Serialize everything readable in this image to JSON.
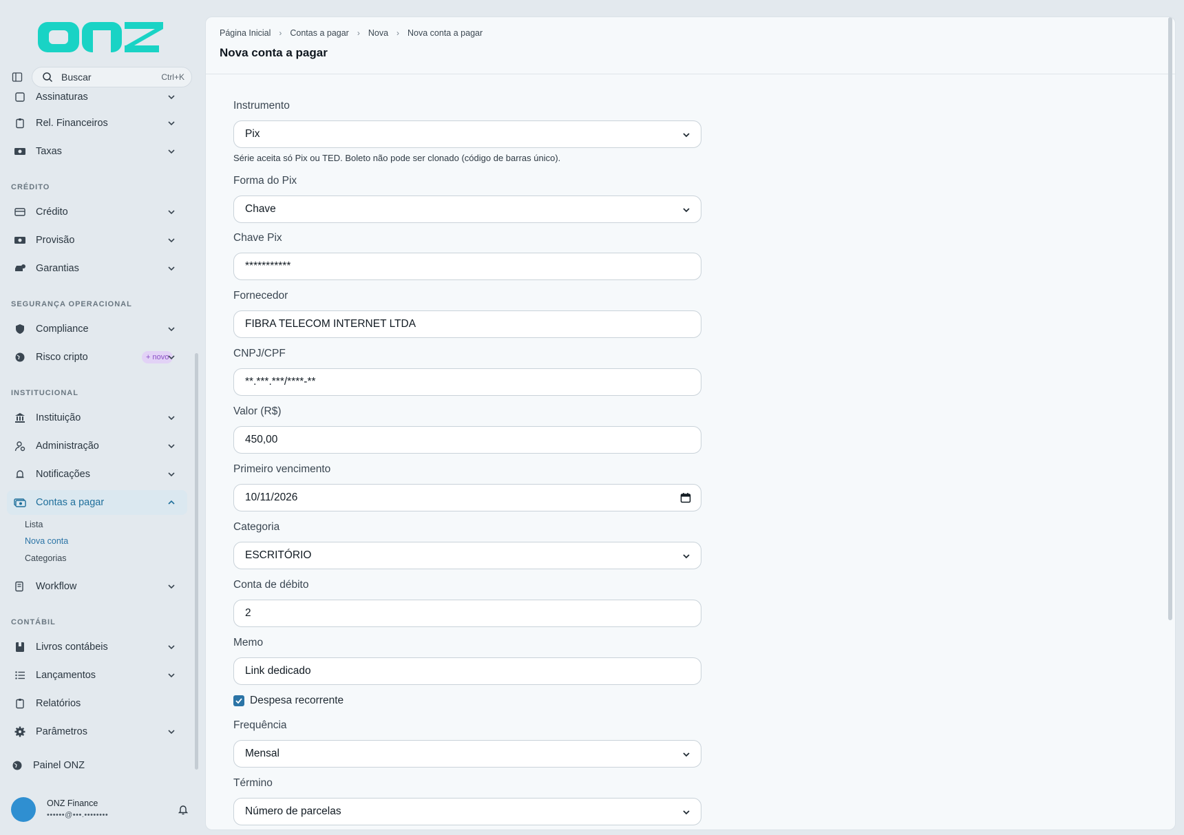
{
  "sidebar": {
    "logo_text": "onz",
    "search_label": "Buscar",
    "search_shortcut": "Ctrl+K",
    "items_top": [
      {
        "label": "Assinaturas"
      },
      {
        "label": "Rel. Financeiros"
      },
      {
        "label": "Taxas"
      }
    ],
    "section_credito": "CRÉDITO",
    "credito_items": [
      {
        "label": "Crédito"
      },
      {
        "label": "Provisão"
      },
      {
        "label": "Garantias"
      }
    ],
    "section_seguranca": "SEGURANÇA OPERACIONAL",
    "seguranca_items": [
      {
        "label": "Compliance"
      },
      {
        "label": "Risco cripto",
        "badge": "+ novo"
      }
    ],
    "section_institucional": "INSTITUCIONAL",
    "institucional_items": [
      {
        "label": "Instituição"
      },
      {
        "label": "Administração"
      },
      {
        "label": "Notificações"
      },
      {
        "label": "Contas a pagar"
      }
    ],
    "contas_sub": [
      {
        "label": "Lista"
      },
      {
        "label": "Nova conta"
      },
      {
        "label": "Categorias"
      }
    ],
    "workflow": "Workflow",
    "section_contabil": "CONTÁBIL",
    "contabil_items": [
      {
        "label": "Livros contábeis"
      },
      {
        "label": "Lançamentos"
      },
      {
        "label": "Relatórios"
      },
      {
        "label": "Parâmetros"
      }
    ],
    "painel": "Painel ONZ",
    "user_name": "ONZ Finance",
    "user_email": "••••••@•••.••••••••"
  },
  "header": {
    "breadcrumbs": [
      "Página Inicial",
      "Contas a pagar",
      "Nova",
      "Nova conta a pagar"
    ],
    "title": "Nova conta a pagar"
  },
  "form": {
    "instrumento_label": "Instrumento",
    "instrumento_value": "Pix",
    "instrumento_hint": "Série aceita só Pix ou TED. Boleto não pode ser clonado (código de barras único).",
    "forma_label": "Forma do Pix",
    "forma_value": "Chave",
    "chave_label": "Chave Pix",
    "chave_value": "***********",
    "fornecedor_label": "Fornecedor",
    "fornecedor_value": "FIBRA TELECOM INTERNET LTDA",
    "cnpj_label": "CNPJ/CPF",
    "cnpj_value": "**.***.***/****-**",
    "valor_label": "Valor (R$)",
    "valor_value": "450,00",
    "vencimento_label": "Primeiro vencimento",
    "vencimento_value": "10/11/2026",
    "categoria_label": "Categoria",
    "categoria_value": "ESCRITÓRIO",
    "conta_label": "Conta de débito",
    "conta_value": "2",
    "memo_label": "Memo",
    "memo_value": "Link dedicado",
    "recorrente_label": "Despesa recorrente",
    "recorrente_checked": true,
    "frequencia_label": "Frequência",
    "frequencia_value": "Mensal",
    "termino_label": "Término",
    "termino_value": "Número de parcelas"
  },
  "colors": {
    "accent": "#2b74a6",
    "logo": "#19d3c5",
    "badge_bg": "#e2d2f6",
    "badge_text": "#8a4fc6"
  }
}
